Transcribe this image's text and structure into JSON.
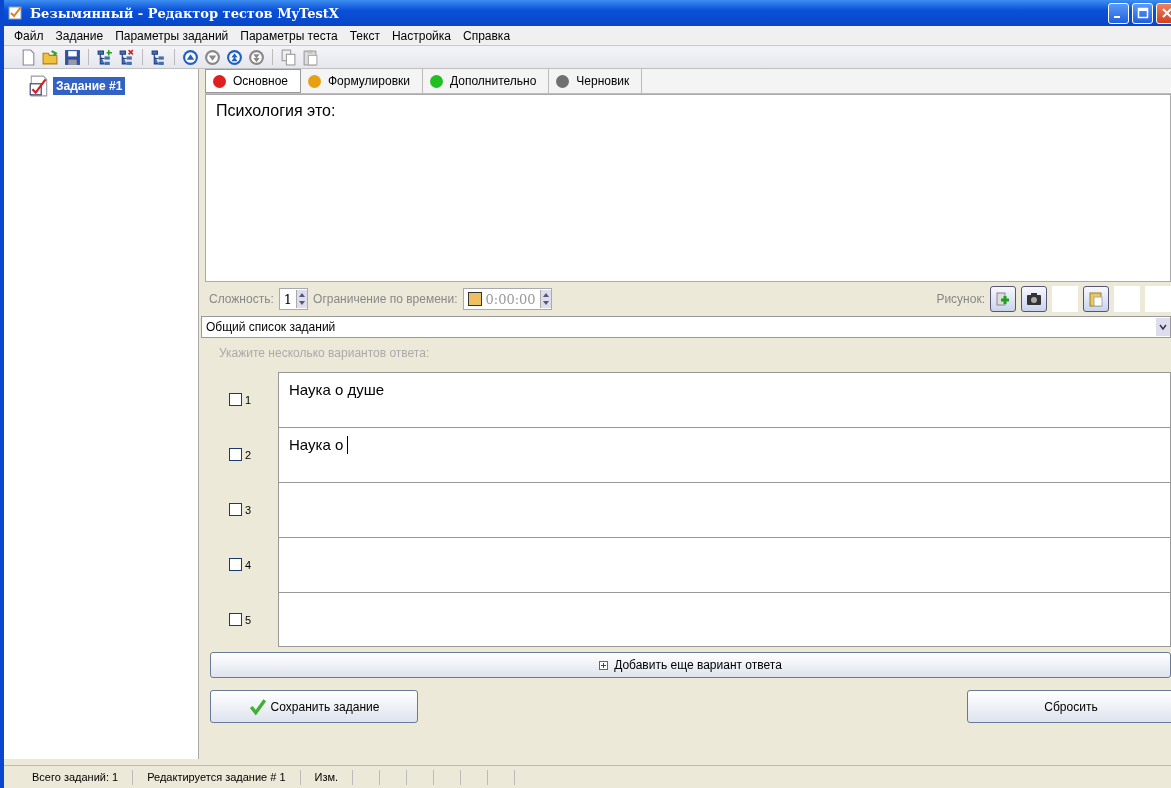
{
  "window": {
    "title": "Безымянный - Редактор тестов MyTestX"
  },
  "menu": [
    "Файл",
    "Задание",
    "Параметры заданий",
    "Параметры теста",
    "Текст",
    "Настройка",
    "Справка"
  ],
  "tree": [
    {
      "label": "Задание #1",
      "selected": true
    }
  ],
  "tabs": [
    {
      "label": "Основное",
      "color": "#e02020",
      "selected": true
    },
    {
      "label": "Формулировки",
      "color": "#e8a010",
      "selected": false
    },
    {
      "label": "Дополнительно",
      "color": "#20c020",
      "selected": false
    },
    {
      "label": "Черновик",
      "color": "#707070",
      "selected": false
    }
  ],
  "question": "Психология это:",
  "difficulty": {
    "label": "Сложность:",
    "value": "1"
  },
  "time_limit": {
    "label": "Ограничение по времени:",
    "checked": false,
    "value": "0:00:00"
  },
  "picture_label": "Рисунок:",
  "task_list": {
    "value": "Общий список заданий"
  },
  "hint": "Укажите несколько вариантов ответа:",
  "answers": [
    {
      "number": "1",
      "checked": false,
      "text": "Наука о душе",
      "focused": false
    },
    {
      "number": "2",
      "checked": false,
      "text": "Наука о",
      "focused": true
    },
    {
      "number": "3",
      "checked": false,
      "focused": false
    },
    {
      "number": "4",
      "checked": false,
      "focused": false
    },
    {
      "number": "5",
      "checked": false,
      "focused": false
    }
  ],
  "add_button": "Добавить еще вариант ответа",
  "save_button": "Сохранить задание",
  "reset_button": "Сбросить",
  "status_bar": [
    "Всего заданий: 1",
    "Редактируется задание # 1",
    "Изм."
  ]
}
